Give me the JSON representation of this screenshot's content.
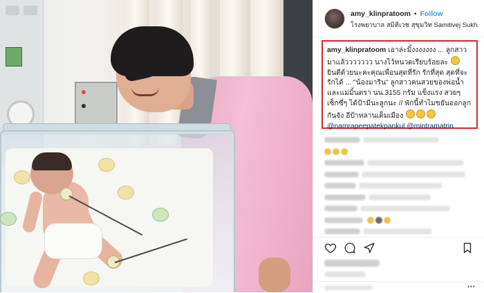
{
  "post": {
    "username": "amy_klinpratoom",
    "separator": "•",
    "follow_label": "Follow",
    "location": "โรงพยาบาล สมิติเวช สุขุมวิท Samitivej Sukh..."
  },
  "caption": {
    "author": "amy_klinpratoom",
    "text_1": "เอาล่ะมิ้งงงงงงง ... ลูกสาวมาแล้ววววววว นางไว้หนวดเรียบร้อยละ",
    "text_2": "ยินดีด้วยนะคะคุณเพื่อนสุดที่รัก รักที่สุด สุดที่จะรักได้ ... \"น้องมาริน\" ลูกสาวคนสวยของพ่อน้ำและแม่มิ้นตรา นน.3155 กรัม แข็งแรง สวยๆ เซ็กซี่ๆ ได้ป้ามีนะลูกนะ // พักนี้ทำไมขยันออกลูกกันจัง อีป้าหลานเต็มเมือง",
    "mention_1": "@namrapeepatekpankul",
    "mention_2": "@mintramatrin"
  },
  "actions": {
    "like": "heart-icon",
    "comment": "comment-icon",
    "share": "share-icon",
    "save": "bookmark-icon"
  },
  "add_comment": {
    "more": "···"
  },
  "colors": {
    "follow": "#3897f0",
    "highlight_box": "#d7262b",
    "mention": "#003569",
    "scrub_pink": "#f0b4cc"
  }
}
